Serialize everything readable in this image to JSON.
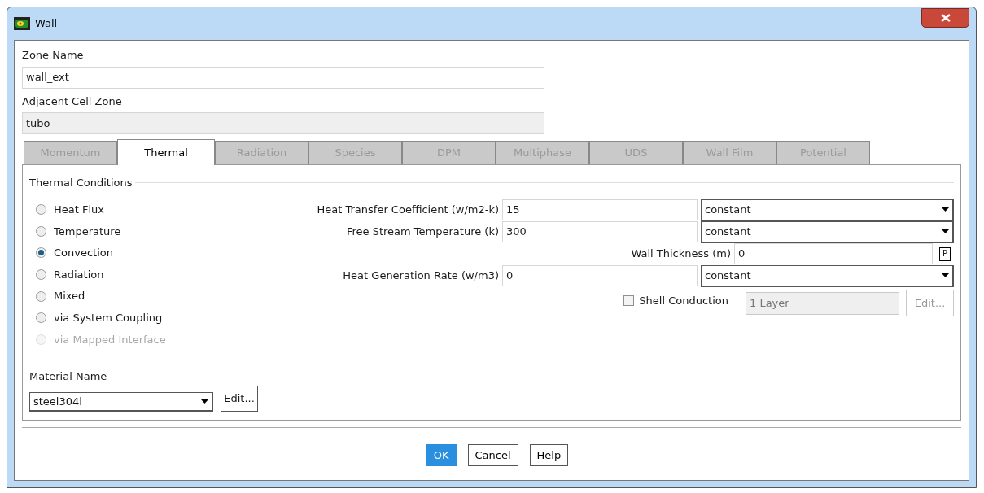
{
  "window": {
    "title": "Wall"
  },
  "zone_name": {
    "label": "Zone Name",
    "value": "wall_ext"
  },
  "adjacent_cell_zone": {
    "label": "Adjacent Cell Zone",
    "value": "tubo",
    "disabled": true
  },
  "tabs": [
    {
      "label": "Momentum",
      "selected": false
    },
    {
      "label": "Thermal",
      "selected": true
    },
    {
      "label": "Radiation",
      "selected": false
    },
    {
      "label": "Species",
      "selected": false
    },
    {
      "label": "DPM",
      "selected": false
    },
    {
      "label": "Multiphase",
      "selected": false
    },
    {
      "label": "UDS",
      "selected": false
    },
    {
      "label": "Wall Film",
      "selected": false
    },
    {
      "label": "Potential",
      "selected": false
    }
  ],
  "thermal_conditions": {
    "title": "Thermal Conditions",
    "options": [
      {
        "label": "Heat Flux",
        "selected": false,
        "disabled": false
      },
      {
        "label": "Temperature",
        "selected": false,
        "disabled": false
      },
      {
        "label": "Convection",
        "selected": true,
        "disabled": false
      },
      {
        "label": "Radiation",
        "selected": false,
        "disabled": false
      },
      {
        "label": "Mixed",
        "selected": false,
        "disabled": false
      },
      {
        "label": "via System Coupling",
        "selected": false,
        "disabled": false
      },
      {
        "label": "via Mapped Interface",
        "selected": false,
        "disabled": true
      }
    ],
    "fields": [
      {
        "kind": "profile",
        "label": "Heat Transfer Coefficient (w/m2-k)",
        "value": "15",
        "method": "constant"
      },
      {
        "kind": "profile",
        "label": "Free Stream Temperature (k)",
        "value": "300",
        "method": "constant"
      },
      {
        "kind": "parameter",
        "label": "Wall Thickness (m)",
        "value": "0",
        "button": "P"
      },
      {
        "kind": "profile",
        "label": "Heat Generation Rate (w/m3)",
        "value": "0",
        "method": "constant"
      },
      {
        "kind": "checkbox",
        "label": "Shell Conduction",
        "checked": false,
        "value": "1 Layer",
        "button": "Edit..."
      }
    ]
  },
  "material": {
    "label": "Material Name",
    "value": "steel304l",
    "button": "Edit..."
  },
  "buttons": [
    {
      "label": "OK",
      "default": true
    },
    {
      "label": "Cancel",
      "default": false
    },
    {
      "label": "Help",
      "default": false
    }
  ]
}
